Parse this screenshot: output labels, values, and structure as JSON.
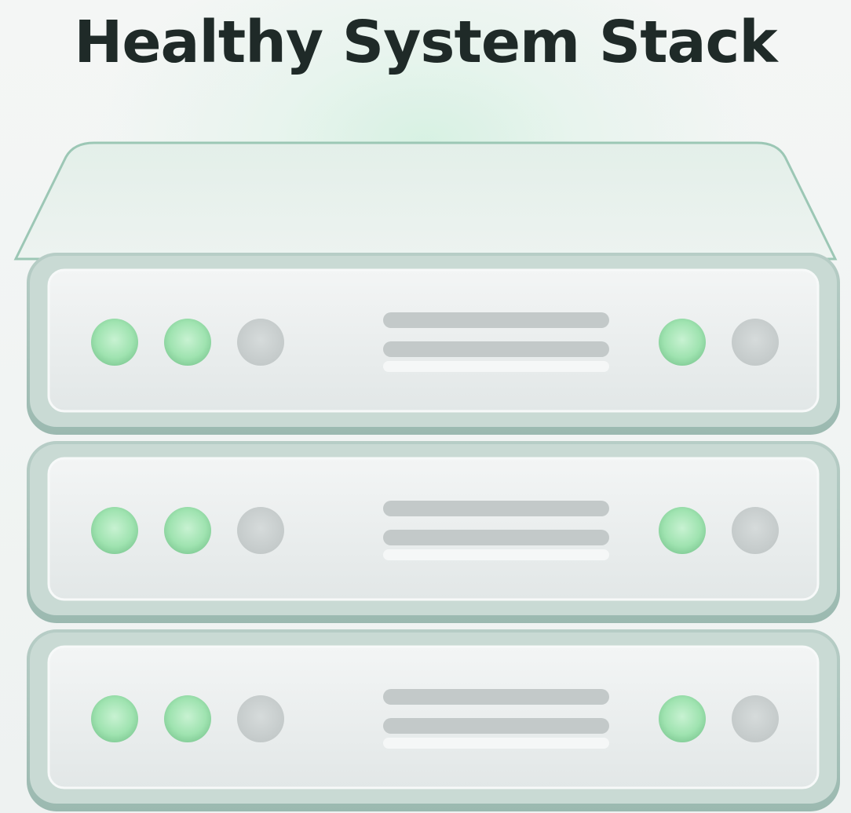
{
  "header": {
    "title": "Healthy System Stack"
  },
  "colors": {
    "led_on": "#9fe3b0",
    "led_off": "#c9cfcf",
    "chassis_edge": "#8fb2a8",
    "panel": "#e8eded",
    "slot_line": "#c3c9c9"
  },
  "units": [
    {
      "leds_left": [
        "on",
        "on",
        "off"
      ],
      "leds_right": [
        "on",
        "off"
      ]
    },
    {
      "leds_left": [
        "on",
        "on",
        "off"
      ],
      "leds_right": [
        "on",
        "off"
      ]
    },
    {
      "leds_left": [
        "on",
        "on",
        "off"
      ],
      "leds_right": [
        "on",
        "off"
      ]
    }
  ]
}
